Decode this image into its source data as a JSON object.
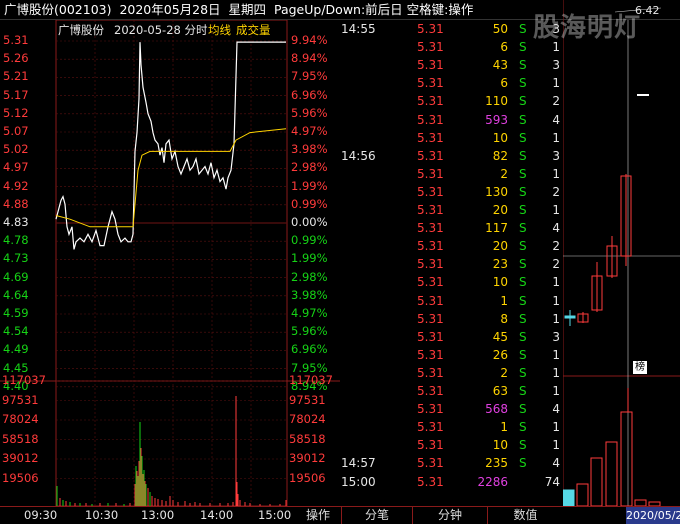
{
  "title": {
    "stock_name": "广博股份(002103)",
    "date": "2020年05月28日",
    "weekday": "星期四",
    "hint": "PageUp/Down:前后日 空格键:操作"
  },
  "chart": {
    "stock_name": "广博股份",
    "date": "2020-05-28 分时",
    "avg_label": "均线",
    "vol_label": "成交量",
    "prev_close": 4.83,
    "price_ticks_up": [
      "5.31",
      "5.26",
      "5.21",
      "5.17",
      "5.12",
      "5.07",
      "5.02",
      "4.97",
      "4.92",
      "4.88"
    ],
    "price_base": "4.83",
    "price_ticks_down": [
      "4.78",
      "4.73",
      "4.69",
      "4.64",
      "4.59",
      "4.54",
      "4.49",
      "4.45",
      "4.40"
    ],
    "pct_ticks_up": [
      "9.94%",
      "8.94%",
      "7.95%",
      "6.96%",
      "5.96%",
      "4.97%",
      "3.98%",
      "2.98%",
      "1.99%",
      "0.99%"
    ],
    "pct_base": "0.00%",
    "pct_ticks_down": [
      "0.99%",
      "1.99%",
      "2.98%",
      "3.98%",
      "4.97%",
      "5.96%",
      "6.96%",
      "7.95%",
      "8.94%"
    ],
    "vol_ticks": [
      "117037",
      "97531",
      "78024",
      "58518",
      "39012",
      "19506"
    ],
    "time_labels": [
      "09:30",
      "10:30",
      "13:00",
      "14:00",
      "15:00"
    ]
  },
  "ticks": [
    {
      "time": "14:55",
      "price": "5.31",
      "vol": "50",
      "side": "S",
      "num": "3",
      "vcolor": "yellow"
    },
    {
      "time": "",
      "price": "5.31",
      "vol": "6",
      "side": "S",
      "num": "1",
      "vcolor": "yellow"
    },
    {
      "time": "",
      "price": "5.31",
      "vol": "43",
      "side": "S",
      "num": "3",
      "vcolor": "yellow"
    },
    {
      "time": "",
      "price": "5.31",
      "vol": "6",
      "side": "S",
      "num": "1",
      "vcolor": "yellow"
    },
    {
      "time": "",
      "price": "5.31",
      "vol": "110",
      "side": "S",
      "num": "2",
      "vcolor": "yellow"
    },
    {
      "time": "",
      "price": "5.31",
      "vol": "593",
      "side": "S",
      "num": "4",
      "vcolor": "magenta"
    },
    {
      "time": "",
      "price": "5.31",
      "vol": "10",
      "side": "S",
      "num": "1",
      "vcolor": "yellow"
    },
    {
      "time": "14:56",
      "price": "5.31",
      "vol": "82",
      "side": "S",
      "num": "3",
      "vcolor": "yellow"
    },
    {
      "time": "",
      "price": "5.31",
      "vol": "2",
      "side": "S",
      "num": "1",
      "vcolor": "yellow"
    },
    {
      "time": "",
      "price": "5.31",
      "vol": "130",
      "side": "S",
      "num": "2",
      "vcolor": "yellow"
    },
    {
      "time": "",
      "price": "5.31",
      "vol": "20",
      "side": "S",
      "num": "1",
      "vcolor": "yellow"
    },
    {
      "time": "",
      "price": "5.31",
      "vol": "117",
      "side": "S",
      "num": "4",
      "vcolor": "yellow"
    },
    {
      "time": "",
      "price": "5.31",
      "vol": "20",
      "side": "S",
      "num": "2",
      "vcolor": "yellow"
    },
    {
      "time": "",
      "price": "5.31",
      "vol": "23",
      "side": "S",
      "num": "2",
      "vcolor": "yellow"
    },
    {
      "time": "",
      "price": "5.31",
      "vol": "10",
      "side": "S",
      "num": "1",
      "vcolor": "yellow"
    },
    {
      "time": "",
      "price": "5.31",
      "vol": "1",
      "side": "S",
      "num": "1",
      "vcolor": "yellow"
    },
    {
      "time": "",
      "price": "5.31",
      "vol": "8",
      "side": "S",
      "num": "1",
      "vcolor": "yellow"
    },
    {
      "time": "",
      "price": "5.31",
      "vol": "45",
      "side": "S",
      "num": "3",
      "vcolor": "yellow"
    },
    {
      "time": "",
      "price": "5.31",
      "vol": "26",
      "side": "S",
      "num": "1",
      "vcolor": "yellow"
    },
    {
      "time": "",
      "price": "5.31",
      "vol": "2",
      "side": "S",
      "num": "1",
      "vcolor": "yellow"
    },
    {
      "time": "",
      "price": "5.31",
      "vol": "63",
      "side": "S",
      "num": "1",
      "vcolor": "yellow"
    },
    {
      "time": "",
      "price": "5.31",
      "vol": "568",
      "side": "S",
      "num": "4",
      "vcolor": "magenta"
    },
    {
      "time": "",
      "price": "5.31",
      "vol": "1",
      "side": "S",
      "num": "1",
      "vcolor": "yellow"
    },
    {
      "time": "",
      "price": "5.31",
      "vol": "10",
      "side": "S",
      "num": "1",
      "vcolor": "yellow"
    },
    {
      "time": "14:57",
      "price": "5.31",
      "vol": "235",
      "side": "S",
      "num": "4",
      "vcolor": "yellow"
    },
    {
      "time": "15:00",
      "price": "5.31",
      "vol": "2286",
      "side": "",
      "num": "74",
      "vcolor": "magenta"
    }
  ],
  "right_panel": {
    "watermark": "股海明灯",
    "price_label": "6.42",
    "badge": "榜",
    "date_label": "2020/05/2"
  },
  "bottom": {
    "tabs": [
      "操作",
      "分笔",
      "分钟",
      "数值"
    ]
  },
  "colors": {
    "up": "#ff3b3b",
    "down": "#16d316",
    "neutral": "#e6e6e6",
    "avg_line": "#ffd400",
    "grid": "#8a1a1a"
  }
}
